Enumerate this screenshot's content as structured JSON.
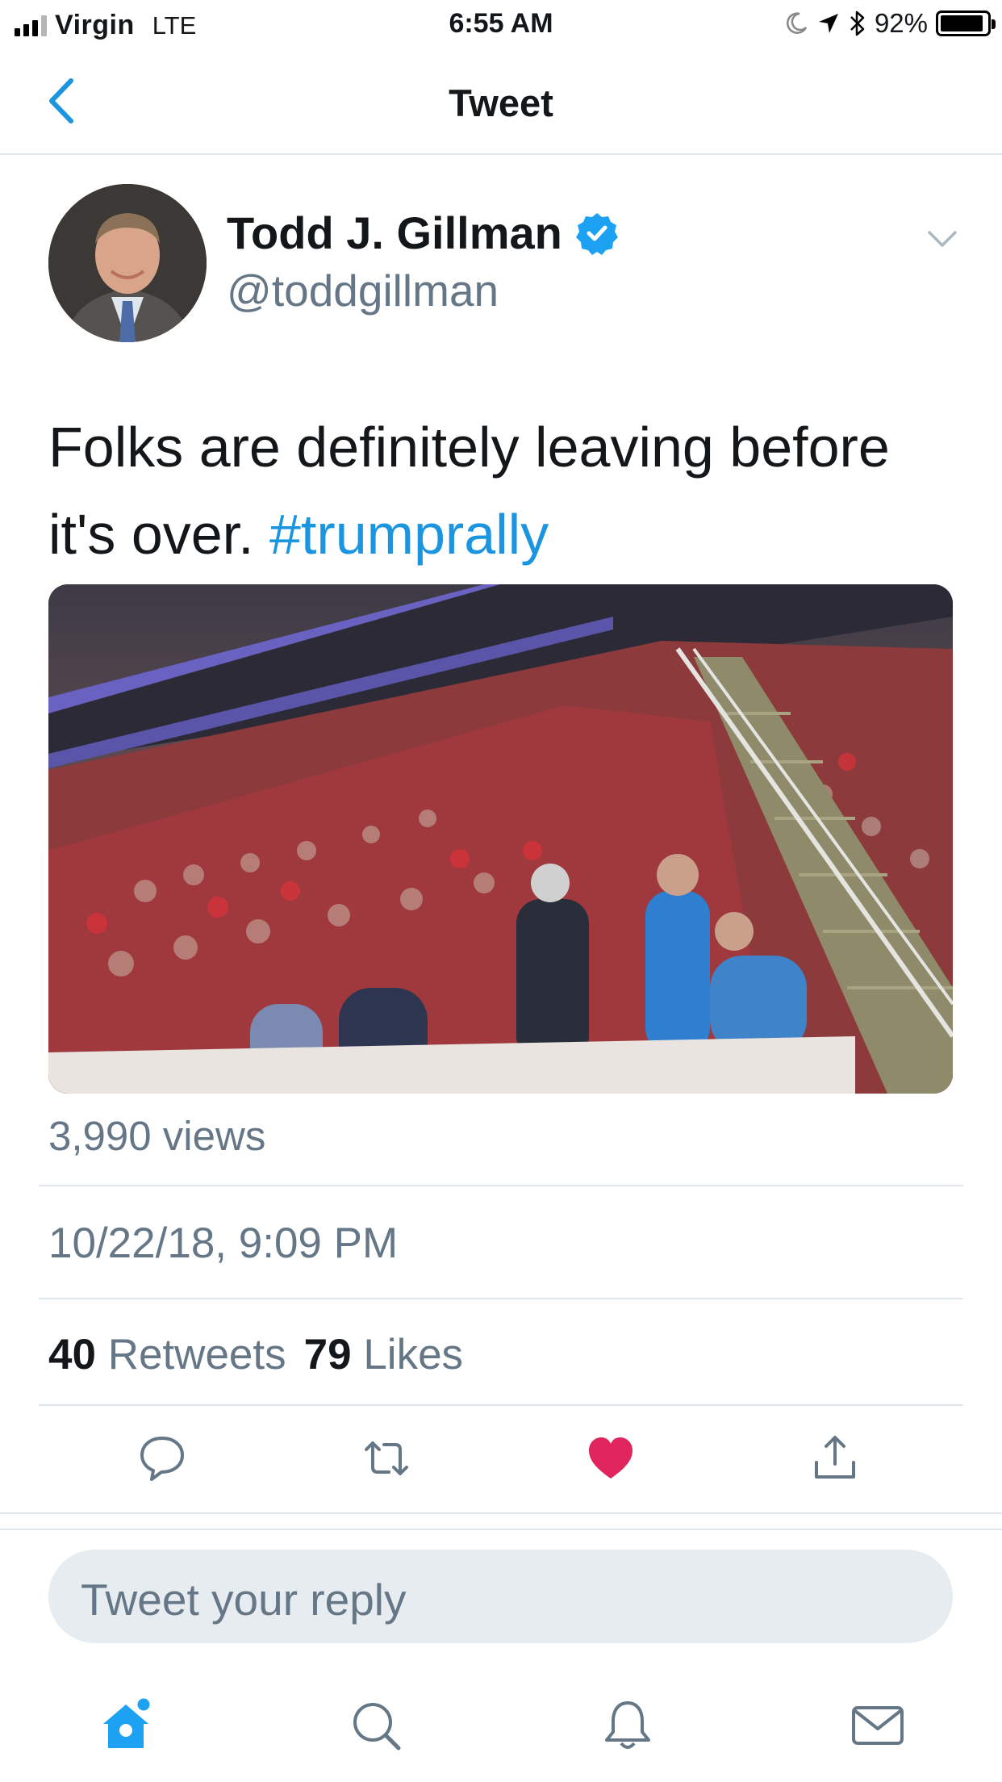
{
  "status_bar": {
    "carrier": "Virgin",
    "network": "LTE",
    "time": "6:55 AM",
    "battery_percent": "92%",
    "battery_level": 0.92,
    "icons": [
      "signal-icon",
      "moon-icon",
      "location-arrow-icon",
      "bluetooth-icon",
      "battery-icon"
    ]
  },
  "nav": {
    "title": "Tweet",
    "back_icon": "chevron-left-icon"
  },
  "tweet": {
    "author_name": "Todd J. Gillman",
    "verified": true,
    "handle": "@toddgillman",
    "text": "Folks are definitely leaving before it's over.",
    "hashtag": "#trumprally",
    "views": "3,990 views",
    "timestamp": "10/22/18, 9:09 PM",
    "retweets_count": "40",
    "retweets_label": "Retweets",
    "likes_count": "79",
    "likes_label": "Likes",
    "liked": true
  },
  "actions": [
    "reply-icon",
    "retweet-icon",
    "like-icon",
    "share-icon"
  ],
  "reply": {
    "placeholder": "Tweet your reply"
  },
  "tab_bar": [
    "home-icon",
    "search-icon",
    "notifications-icon",
    "messages-icon"
  ],
  "colors": {
    "accent": "#1b95e0",
    "like": "#e0245e",
    "secondary_text": "#657786",
    "divider": "#e1e8ed",
    "reply_bg": "#e6ecf0"
  }
}
